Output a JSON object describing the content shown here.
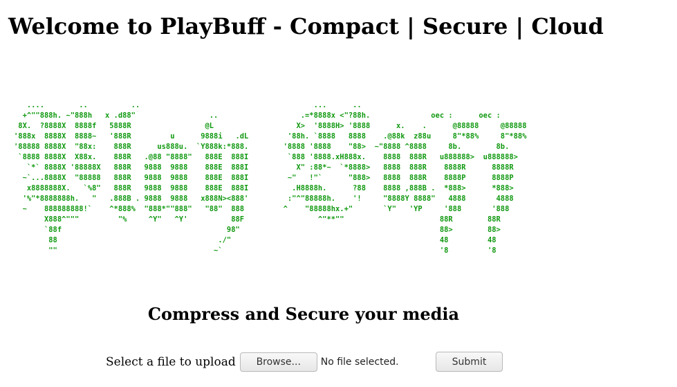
{
  "header": {
    "title": "Welcome to PlayBuff - Compact | Secure | Cloud"
  },
  "logo": {
    "color": "#119911",
    "ascii": "   ....        ..          ..                                        ...      ..\n  +^\"\"888h. ~\"888h   x .d88\"                 ..                   .=*8888x <\"?88h.              oec :      oec :\n 8X.  ?8888X  8888f   5888R                 @L                   X>  '8888H> '8888      x.    .      @88888     @88888\n'888x  8888X  8888~   '888R         u      9888i   .dL         '88h. `8888   8888    .@88k  z88u     8\"*88%     8\"*88%\n'88888 8888X  \"88x:    888R      us888u.  `Y888k:*888.        '8888 '8888    \"88>  ~\"8888 ^8888     8b.        8b.\n `8888 8888X  X88x.    888R   .@88 \"8888\"   888E  888I         `888 '8888.xH888x.    8888  888R   u888888>  u888888>\n   `*` 8888X '88888X   888R   9888  9888    888E  888I           X\" :88*~  `*8888>   8888  888R    8888R      8888R\n  ~`...8888X  \"88888   888R   9888  9888    888E  888I         ~\"   !\"`      \"888>   8888  888R    8888P      8888P\n   x8888888X.   `%8\"   888R   9888  9888    888E  888I          .H8888h.      ?88    8888 ,888B .  *888>      *888>\n  '%\"*8888888h.   \"   .888B . 9888  9888   x888N><888'         :\"^\"88888h.    '!     \"8888Y 8888\"   4888       4888\n  ~    888888888!`    ^*888%  \"888*\"\"888\"   \"88\"  888         ^    \"88888hx.+\"       `Y\"   'YP     '888       '888\n       X888^\"\"\"         \"%     ^Y\"   ^Y'          88F                 ^\"**\"\"                      88R        88R\n       `88f                                      98\"                                              88>        88>\n        88                                     ./\"                                                48         48\n        \"\"                                    ~`                                                  '8         '8"
  },
  "main": {
    "subtitle": "Compress and Secure your media"
  },
  "upload": {
    "label": "Select a file to upload",
    "browse_label": "Browse...",
    "file_status": "No file selected.",
    "submit_label": "Submit"
  }
}
